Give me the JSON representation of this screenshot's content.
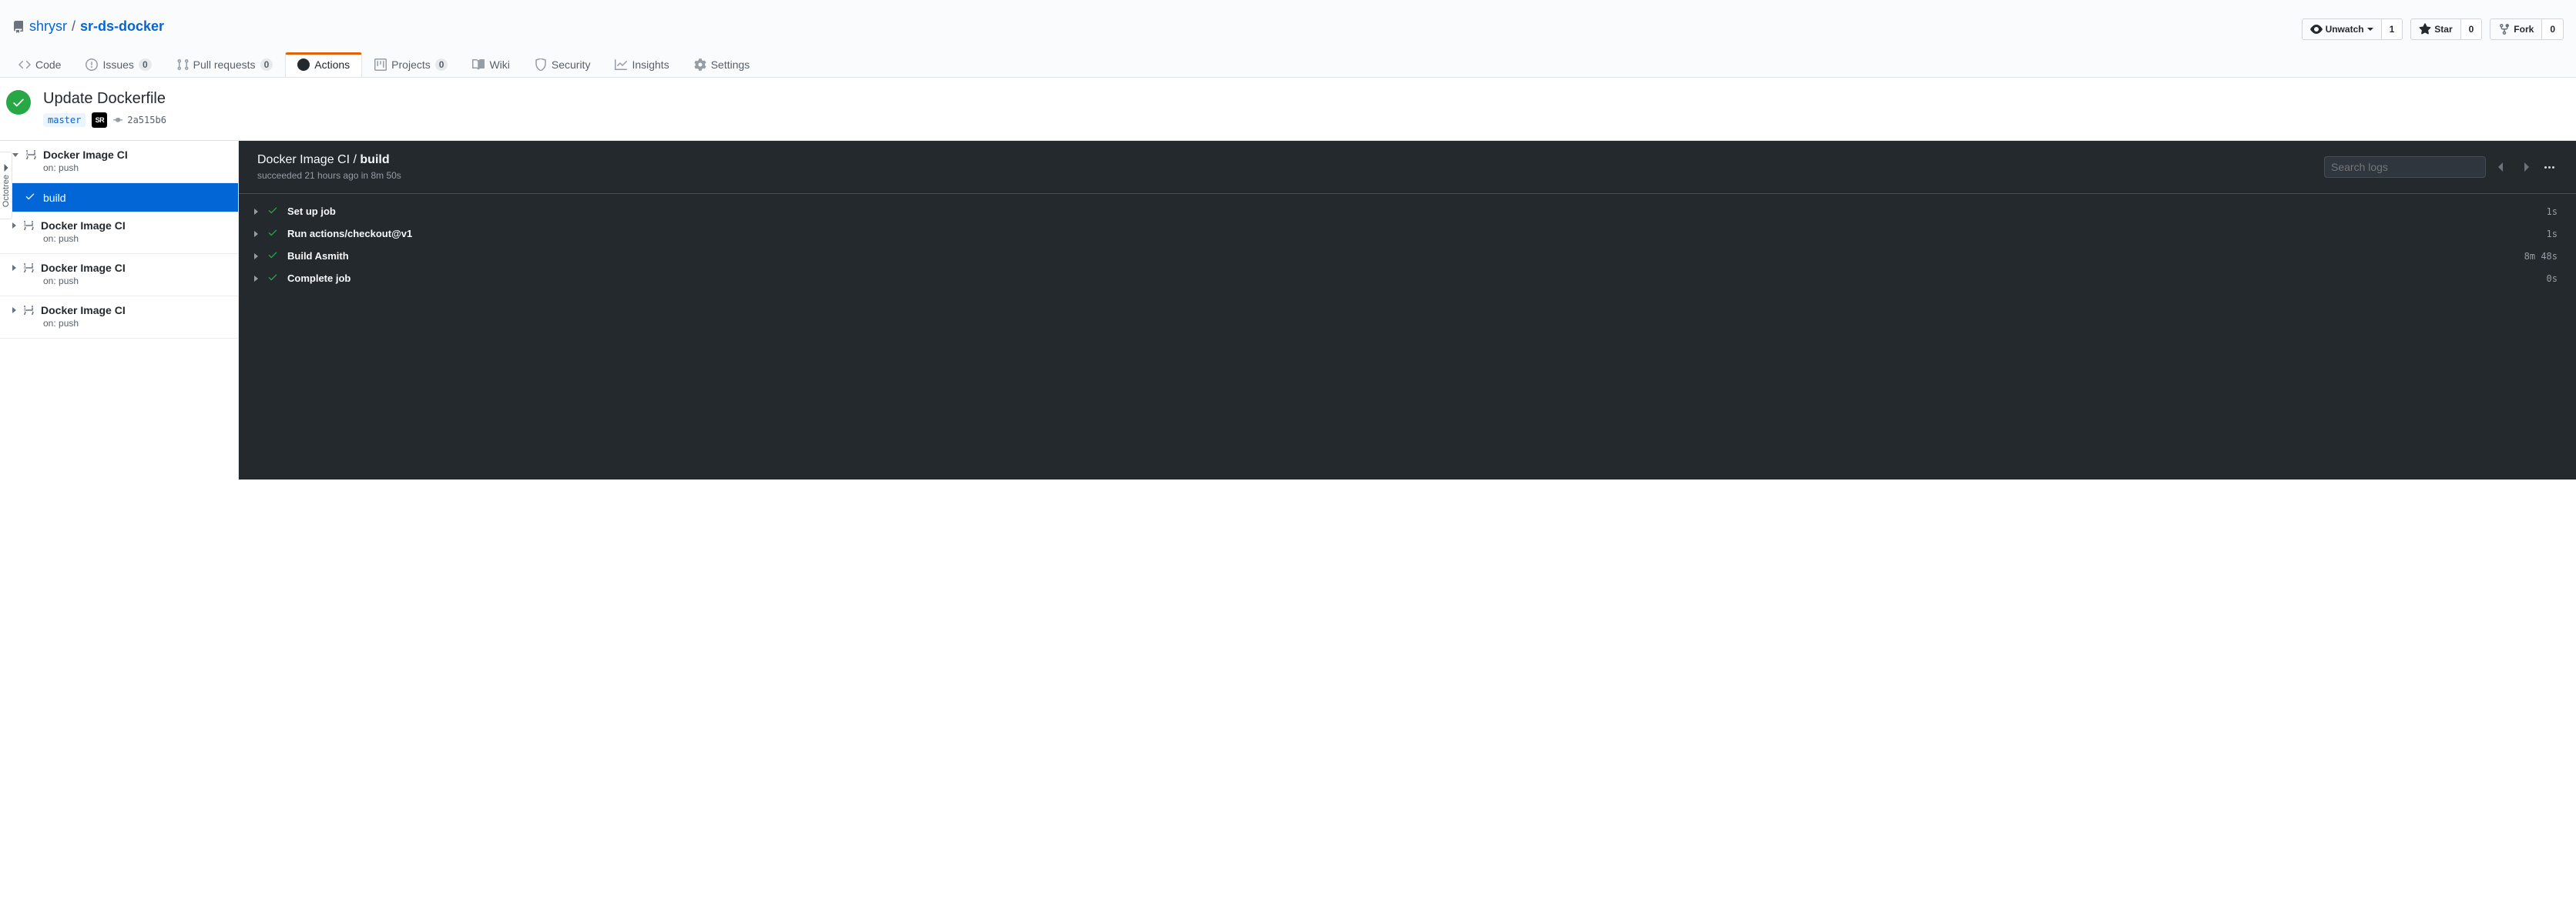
{
  "repo": {
    "owner": "shrysr",
    "name": "sr-ds-docker",
    "sep": "/"
  },
  "actions": {
    "unwatch": {
      "label": "Unwatch",
      "count": "1"
    },
    "star": {
      "label": "Star",
      "count": "0"
    },
    "fork": {
      "label": "Fork",
      "count": "0"
    }
  },
  "tabs": {
    "code": "Code",
    "issues": {
      "label": "Issues",
      "count": "0"
    },
    "pulls": {
      "label": "Pull requests",
      "count": "0"
    },
    "actions": "Actions",
    "projects": {
      "label": "Projects",
      "count": "0"
    },
    "wiki": "Wiki",
    "security": "Security",
    "insights": "Insights",
    "settings": "Settings"
  },
  "run": {
    "title": "Update Dockerfile",
    "branch": "master",
    "avatar_text": "SR",
    "sha": "2a515b6"
  },
  "sidebar": {
    "octotree": "Octotree",
    "groups": [
      {
        "name": "Docker Image CI",
        "sub": "on: push",
        "expanded": true,
        "jobs": [
          {
            "name": "build",
            "selected": true
          }
        ]
      },
      {
        "name": "Docker Image CI",
        "sub": "on: push",
        "expanded": false
      },
      {
        "name": "Docker Image CI",
        "sub": "on: push",
        "expanded": false
      },
      {
        "name": "Docker Image CI",
        "sub": "on: push",
        "expanded": false
      }
    ]
  },
  "log": {
    "workflow": "Docker Image CI",
    "sep": " / ",
    "job": "build",
    "subtitle": "succeeded 21 hours ago in 8m 50s",
    "search_placeholder": "Search logs",
    "steps": [
      {
        "name": "Set up job",
        "time": "1s"
      },
      {
        "name": "Run actions/checkout@v1",
        "time": "1s"
      },
      {
        "name": "Build Asmith",
        "time": "8m 48s"
      },
      {
        "name": "Complete job",
        "time": "0s"
      }
    ]
  }
}
